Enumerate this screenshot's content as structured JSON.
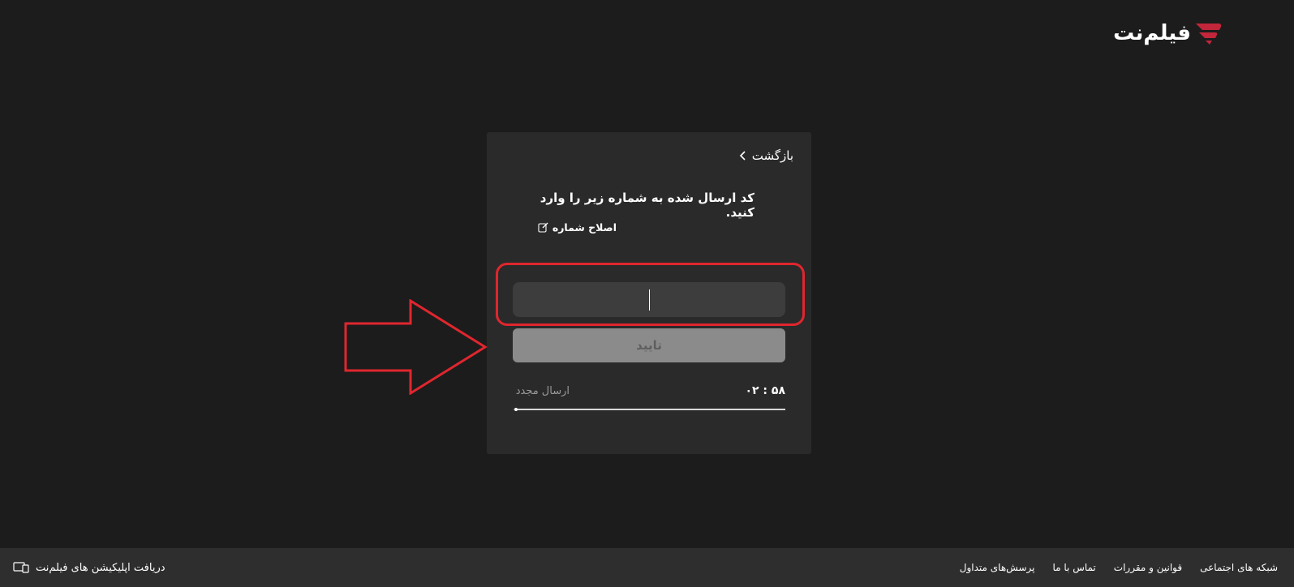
{
  "brand": {
    "logo_text": "فیلم‌نت",
    "accent_color": "#c2263a"
  },
  "card": {
    "back_label": "بازگشت",
    "instruction": "کد ارسال شده به شماره زیر را وارد کنید.",
    "edit_number_label": "اصلاح شماره",
    "code_input_value": "",
    "confirm_label": "تایید",
    "timer": "۰۲ : ۵۸",
    "resend_label": "ارسال مجدد",
    "resend_progress_percent": 99
  },
  "annotation": {
    "highlight_color": "#e0262e"
  },
  "footer": {
    "links": [
      "پرسش‌های متداول",
      "تماس با ما",
      "قوانین و مقررات",
      "شبکه های اجتماعی"
    ],
    "app_download_label": "دریافت اپلیکیشن های فیلم‌نت"
  }
}
